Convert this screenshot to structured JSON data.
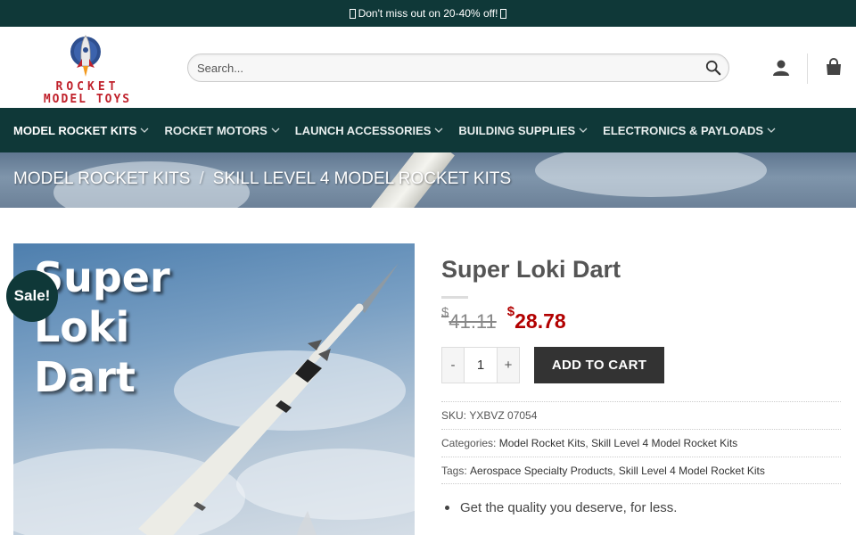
{
  "promo": {
    "text": "Don't miss out on 20-40% off!"
  },
  "brand": {
    "line1": "ROCKET",
    "line2": "MODEL TOYS"
  },
  "search": {
    "placeholder": "Search..."
  },
  "nav": {
    "items": [
      {
        "label": "MODEL ROCKET KITS"
      },
      {
        "label": "ROCKET MOTORS"
      },
      {
        "label": "LAUNCH ACCESSORIES"
      },
      {
        "label": "BUILDING SUPPLIES"
      },
      {
        "label": "ELECTRONICS & PAYLOADS"
      }
    ]
  },
  "breadcrumb": {
    "items": [
      "MODEL ROCKET KITS",
      "SKILL LEVEL 4 MODEL ROCKET KITS"
    ],
    "separator": "/"
  },
  "product": {
    "image_text": [
      "Super",
      "Loki",
      "Dart"
    ],
    "sale_badge": "Sale!",
    "title": "Super Loki Dart",
    "currency": "$",
    "old_price": "41.11",
    "price": "28.78",
    "qty_minus": "-",
    "qty_plus": "+",
    "quantity": "1",
    "add_to_cart": "ADD TO CART",
    "sku_label": "SKU:",
    "sku": "YXBVZ 07054",
    "categories_label": "Categories:",
    "categories": [
      "Model Rocket Kits",
      "Skill Level 4 Model Rocket Kits"
    ],
    "tags_label": "Tags:",
    "tags": [
      "Aerospace Specialty Products",
      "Skill Level 4 Model Rocket Kits"
    ],
    "bullet": "Get the quality you deserve, for less."
  },
  "colors": {
    "dark_teal": "#0f3838",
    "sale_red": "#b20000",
    "brand_red": "#c0222c",
    "button_dark": "#333333"
  }
}
